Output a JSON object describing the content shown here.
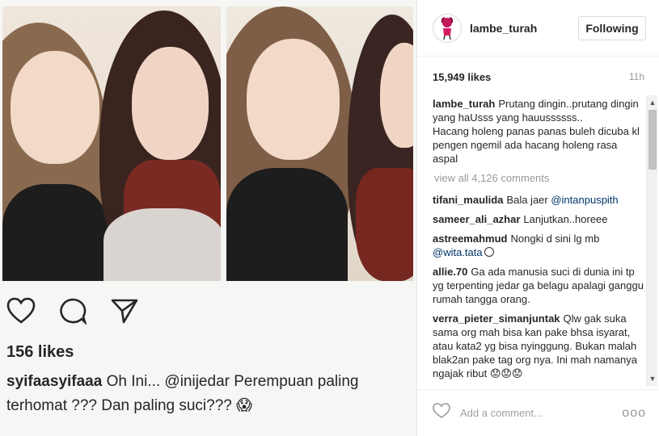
{
  "post_image": {
    "likes": "156 likes",
    "caption_user": "syifaasyifaaa",
    "caption_text": " Oh Ini... @inijedar Perempuan paling terhomat ??? Dan paling suci??? 😱"
  },
  "header": {
    "username": "lambe_turah",
    "follow_label": "Following"
  },
  "stats": {
    "likes": "15,949 likes",
    "time": "11h"
  },
  "caption": {
    "user": "lambe_turah",
    "text": "Prutang dingin..prutang dingin\nyang haUsss yang hauussssss..\nHacang holeng panas panas buleh dicuba kl pengen ngemil ada hacang holeng rasa aspal"
  },
  "view_all": "view all 4,126 comments",
  "comments": [
    {
      "user": "tifani_maulida",
      "text": "Bala jaer ",
      "mention": "@intanpuspith"
    },
    {
      "user": "sameer_ali_azhar",
      "text": "Lanjutkan..horeee",
      "mention": ""
    },
    {
      "user": "astreemahmud",
      "text": "Nongki d sini lg mb ",
      "mention": "@wita.tata",
      "emoji": true
    },
    {
      "user": "allie.70",
      "text": "Ga ada manusia suci di dunia ini tp yg terpenting jedar ga belagu apalagi ganggu rumah tangga orang.",
      "mention": ""
    },
    {
      "user": "verra_pieter_simanjuntak",
      "text": "Qlw gak suka sama org mah bisa kan pake bhsa isyarat, atau kata2 yg bisa nyinggung. Bukan malah blak2an pake tag org nya. Ini mah namanya ngajak ribut 😟😟😟",
      "mention": ""
    }
  ],
  "add_comment": {
    "placeholder": "Add a comment...",
    "more": "ooo"
  },
  "icons": {
    "like": "heart-icon",
    "comment": "comment-bubble-icon",
    "share": "send-icon",
    "scroll_up": "chevron-up-icon",
    "scroll_down": "chevron-down-icon"
  }
}
